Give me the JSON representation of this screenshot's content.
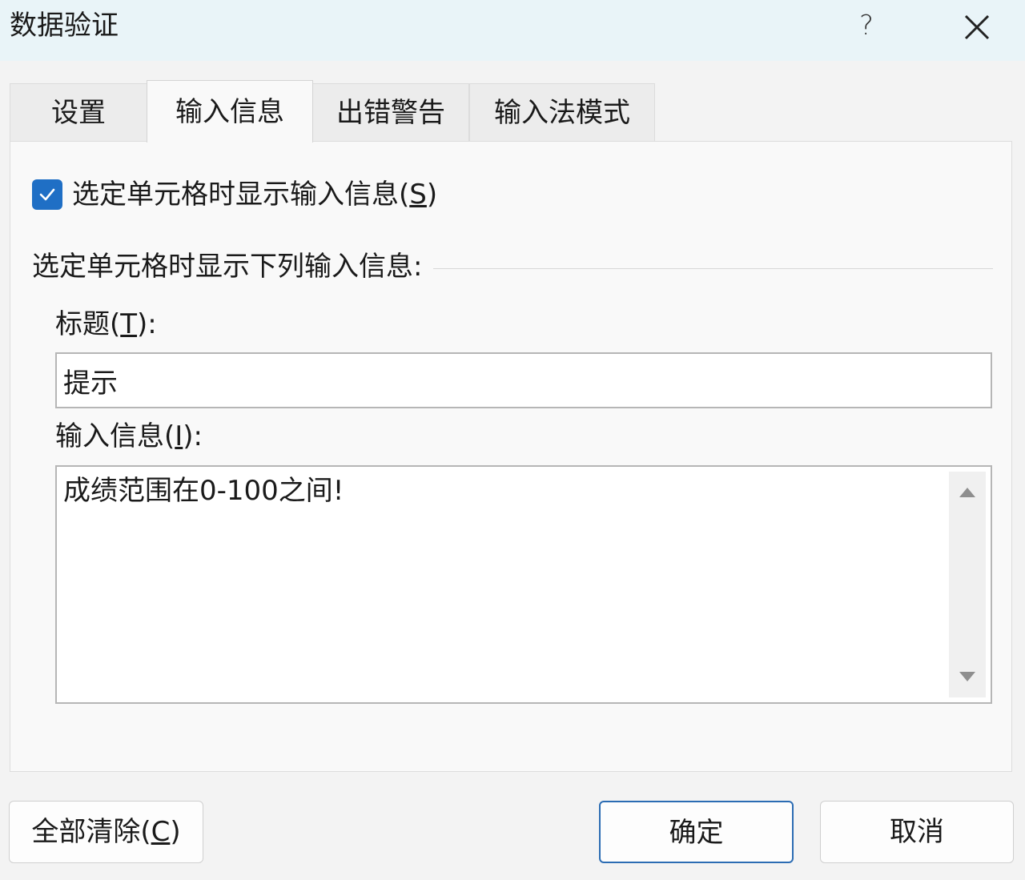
{
  "window": {
    "title": "数据验证",
    "help_label": "?"
  },
  "tabs": [
    {
      "label": "设置"
    },
    {
      "label": "输入信息"
    },
    {
      "label": "出错警告"
    },
    {
      "label": "输入法模式"
    }
  ],
  "active_tab": "输入信息",
  "input_message": {
    "show_checkbox": {
      "checked": true,
      "label_prefix": "选定单元格时显示输入信息(",
      "label_key": "S",
      "label_suffix": ")"
    },
    "section_label": "选定单元格时显示下列输入信息:",
    "title_label": {
      "prefix": "标题(",
      "key": "T",
      "suffix": "):"
    },
    "title_value": "提示",
    "message_label": {
      "prefix": "输入信息(",
      "key": "I",
      "suffix": "):"
    },
    "message_value": "成绩范围在0-100之间!"
  },
  "buttons": {
    "clear_all": {
      "prefix": "全部清除(",
      "key": "C",
      "suffix": ")"
    },
    "ok": "确定",
    "cancel": "取消"
  },
  "colors": {
    "titlebar": "#e9f4f8",
    "checkbox_accent": "#1f6fc5",
    "primary_button_border": "#2b6cb3"
  }
}
